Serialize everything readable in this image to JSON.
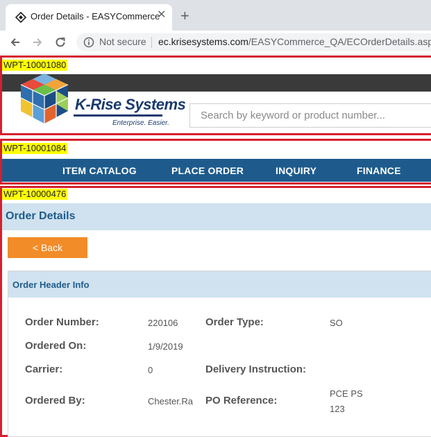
{
  "browser": {
    "tab_title": "Order Details - EASYCommerce",
    "close_glyph": "✕",
    "new_tab_glyph": "+",
    "security_label": "Not secure",
    "url_host": "ec.krisesystems.com",
    "url_path": "/EASYCommerce_QA/ECOrderDetails.aspx?S"
  },
  "annotations": {
    "header_id": "WPT-10001080",
    "nav_id": "WPT-10001084",
    "content_id": "WPT-10000476"
  },
  "header": {
    "brand_name": "K-Rise Systems",
    "tagline": "Enterprise. Easier.",
    "search_placeholder": "Search by keyword or product number..."
  },
  "nav": {
    "items": [
      "ITEM CATALOG",
      "PLACE ORDER",
      "INQUIRY",
      "FINANCE"
    ]
  },
  "page": {
    "title": "Order Details",
    "back_label": "< Back"
  },
  "order_header": {
    "title": "Order Header Info",
    "order_number_label": "Order Number:",
    "order_number": "220106",
    "order_type_label": "Order Type:",
    "order_type": "SO",
    "ordered_on_label": "Ordered On:",
    "ordered_on": "1/9/2019",
    "carrier_label": "Carrier:",
    "carrier": "0",
    "delivery_label": "Delivery Instruction:",
    "ordered_by_label": "Ordered By:",
    "ordered_by": "Chester.Ra",
    "po_reference_label": "PO Reference:",
    "po_reference_line1": "PCE PS",
    "po_reference_line2": "123"
  },
  "colors": {
    "nav_bg": "#1e5b8c",
    "band_bg": "#d0e2ef",
    "accent_orange": "#f28c28",
    "annotation_red": "#d6202f",
    "annotation_yellow": "#ffff00"
  }
}
